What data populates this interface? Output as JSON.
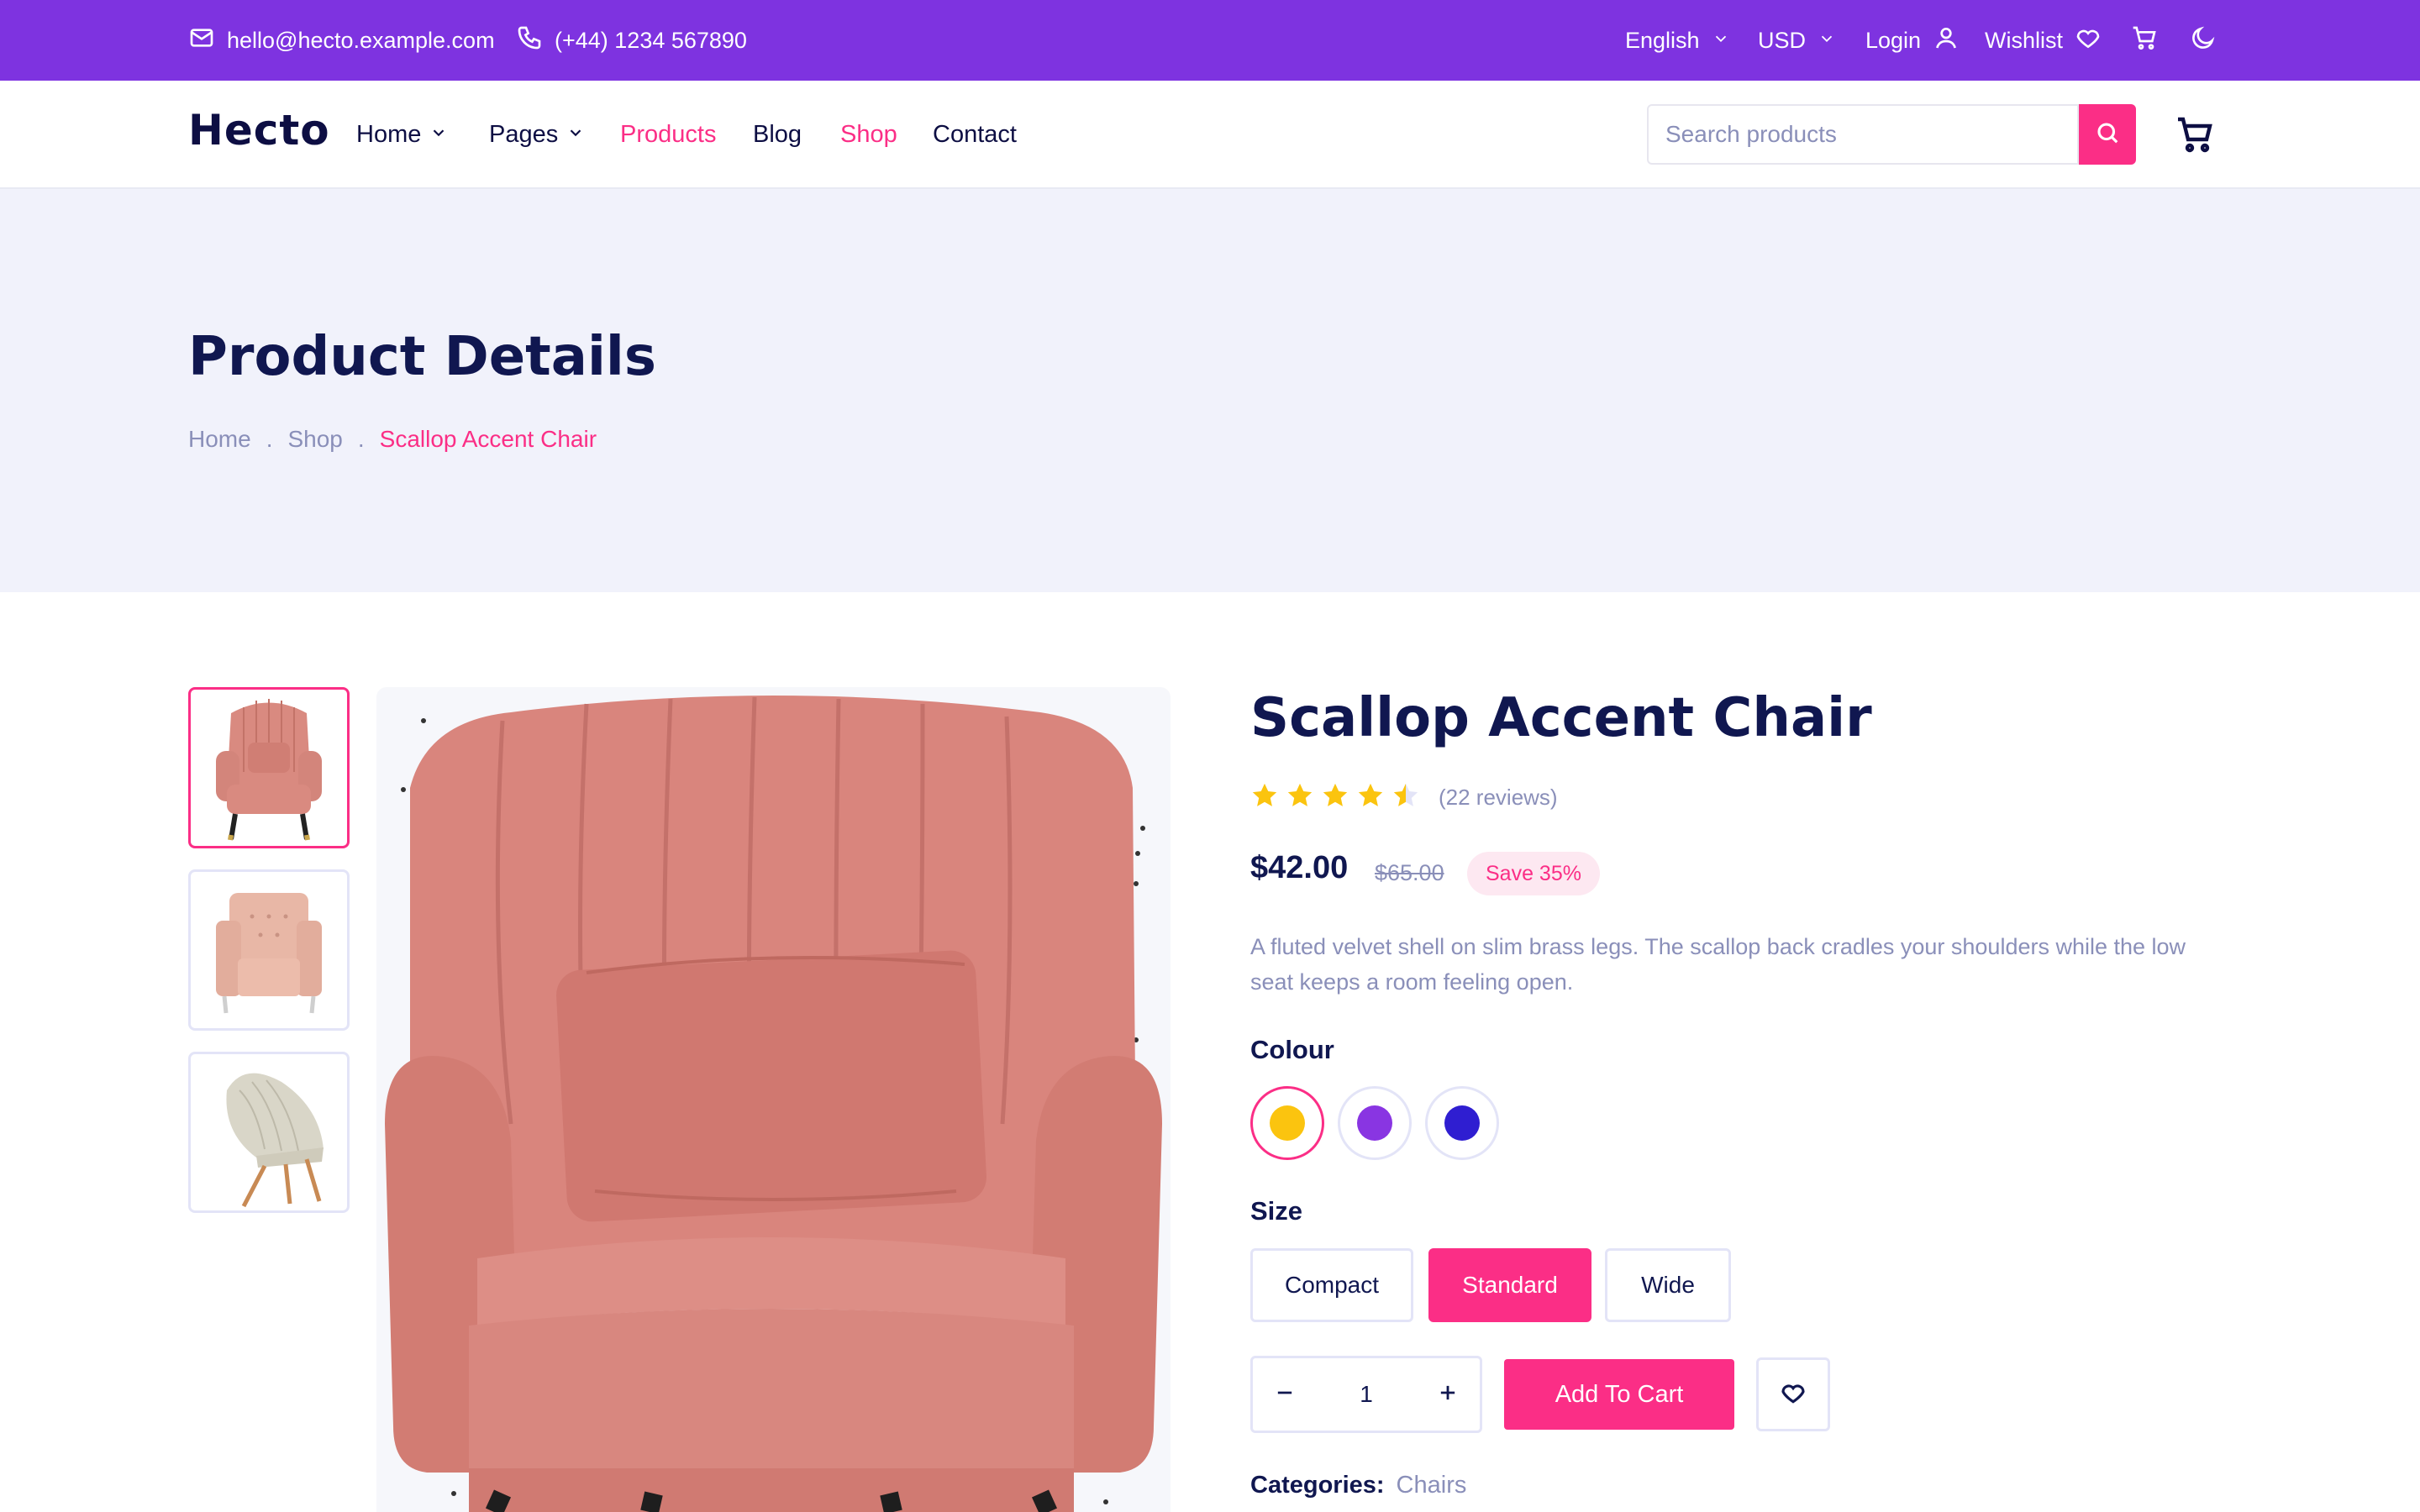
{
  "topbar": {
    "email": "hello@hecto.example.com",
    "phone": "(+44) 1234 567890",
    "language": "English",
    "currency": "USD",
    "login": "Login",
    "wishlist": "Wishlist"
  },
  "header": {
    "logo": "Hecto",
    "nav": [
      "Home",
      "Pages",
      "Products",
      "Blog",
      "Shop",
      "Contact"
    ],
    "search_placeholder": "Search products"
  },
  "hero": {
    "title": "Product Details",
    "breadcrumb": [
      "Home",
      ".",
      "Shop",
      ".",
      "Scallop Accent Chair"
    ]
  },
  "product": {
    "name": "Scallop Accent Chair",
    "rating": 4.5,
    "reviews": "(22 reviews)",
    "price": "$42.00",
    "old_price": "$65.00",
    "save": "Save 35%",
    "description": "A fluted velvet shell on slim brass legs. The scallop back cradles your shoulders while the low seat keeps a room feeling open.",
    "colour_label": "Colour",
    "colours": [
      "#fbc40f",
      "#8935e2",
      "#2f1ed1"
    ],
    "size_label": "Size",
    "sizes": [
      "Compact",
      "Standard",
      "Wide"
    ],
    "selected_size": "Standard",
    "quantity": "1",
    "add_to_cart": "Add To Cart",
    "categories_label": "Categories:",
    "categories_value": "Chairs"
  },
  "colors": {
    "brand_purple": "#7e33e0",
    "accent_pink": "#fb2e86",
    "navy": "#101750",
    "muted": "#8a8fb9",
    "star": "#fbc40f"
  }
}
